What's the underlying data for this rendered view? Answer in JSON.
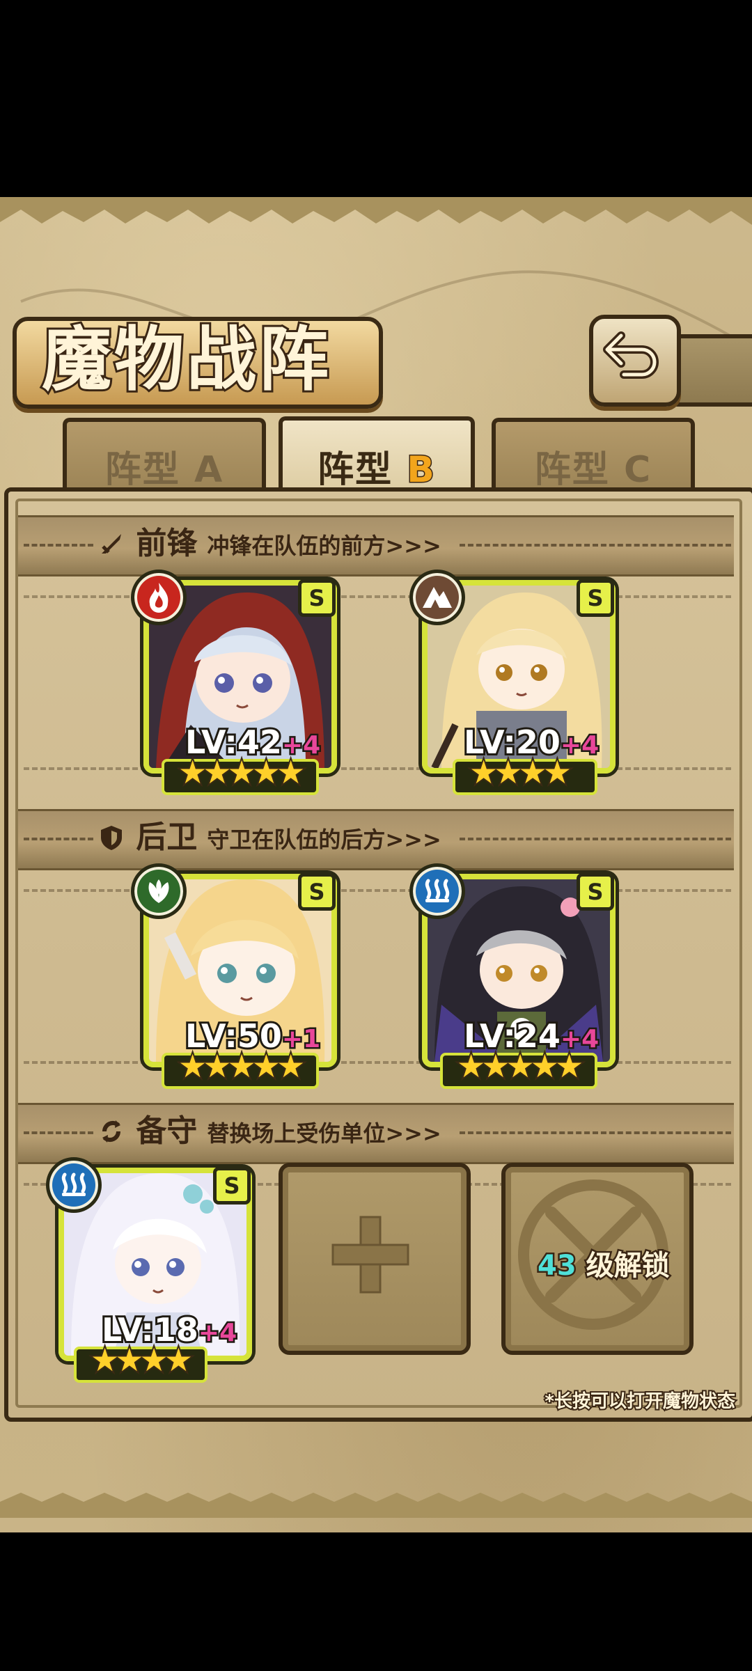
{
  "header": {
    "title": "魔物战阵"
  },
  "tabs": [
    {
      "prefix": "阵型",
      "letter": "A",
      "active": false
    },
    {
      "prefix": "阵型",
      "letter": "B",
      "active": true
    },
    {
      "prefix": "阵型",
      "letter": "C",
      "active": false
    }
  ],
  "sections": {
    "front": {
      "title": "前锋",
      "desc": "冲锋在队伍的前方>>>",
      "icon": "sword-icon"
    },
    "back": {
      "title": "后卫",
      "desc": "守卫在队伍的后方>>>",
      "icon": "shield-icon"
    },
    "reserve": {
      "title": "备守",
      "desc": "替换场上受伤单位>>>",
      "icon": "swap-icon"
    }
  },
  "units": {
    "front_1": {
      "rank": "S",
      "level": "LV:42",
      "plus": "+4",
      "stars": "★★★★★",
      "element": "fire",
      "element_color": "#c8261e"
    },
    "front_2": {
      "rank": "S",
      "level": "LV:20",
      "plus": "+4",
      "stars": "★★★★",
      "element": "earth",
      "element_color": "#6e4a34"
    },
    "back_1": {
      "rank": "S",
      "level": "LV:50",
      "plus": "+1",
      "stars": "★★★★★",
      "element": "wind",
      "element_color": "#2e6a2a"
    },
    "back_2": {
      "rank": "S",
      "level": "LV:24",
      "plus": "+4",
      "stars": "★★★★★",
      "element": "water",
      "element_color": "#1f6fb8"
    },
    "reserve_1": {
      "rank": "S",
      "level": "LV:18",
      "plus": "+4",
      "stars": "★★★★",
      "element": "water",
      "element_color": "#1f6fb8"
    }
  },
  "locked_slot": {
    "level": "43",
    "label": "级解锁"
  },
  "footer_hint": "*长按可以打开魔物状态"
}
